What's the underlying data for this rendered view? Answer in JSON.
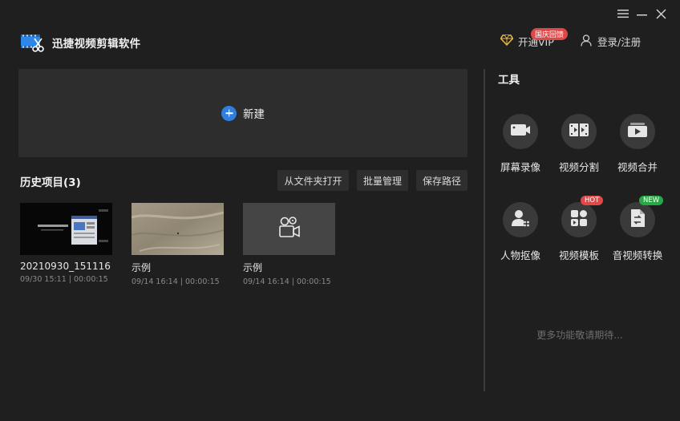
{
  "window": {
    "menu_icon": "hamburger-menu-icon",
    "minimize_icon": "minimize-icon",
    "close_icon": "close-icon"
  },
  "header": {
    "app_title": "迅捷视频剪辑软件",
    "vip_label": "开通VIP",
    "promo_badge": "国庆回馈",
    "login_label": "登录/注册"
  },
  "new_project": {
    "label": "新建"
  },
  "history": {
    "title": "历史项目(3)",
    "buttons": [
      "从文件夹打开",
      "批量管理",
      "保存路径"
    ],
    "items": [
      {
        "name": "20210930_151116",
        "meta": "09/30 15:11 | 00:00:15"
      },
      {
        "name": "示例",
        "meta": "09/14 16:14 | 00:00:15"
      },
      {
        "name": "示例",
        "meta": "09/14 16:14 | 00:00:15"
      }
    ]
  },
  "tools": {
    "title": "工具",
    "items": [
      {
        "label": "屏幕录像",
        "icon": "screen-record-icon"
      },
      {
        "label": "视频分割",
        "icon": "video-split-icon"
      },
      {
        "label": "视频合并",
        "icon": "video-merge-icon"
      },
      {
        "label": "人物抠像",
        "icon": "person-cutout-icon",
        "badge": ""
      },
      {
        "label": "视频模板",
        "icon": "video-template-icon",
        "badge": "HOT"
      },
      {
        "label": "音视频转换",
        "icon": "av-convert-icon",
        "badge": "NEW"
      }
    ],
    "more_text": "更多功能敬请期待..."
  },
  "colors": {
    "background": "#1f1f1f",
    "panel": "#2d2d2d",
    "accent_blue": "#2f7fe0",
    "vip_gold": "#e8b84a",
    "hot_badge": "#e04747",
    "new_badge": "#27a844"
  }
}
